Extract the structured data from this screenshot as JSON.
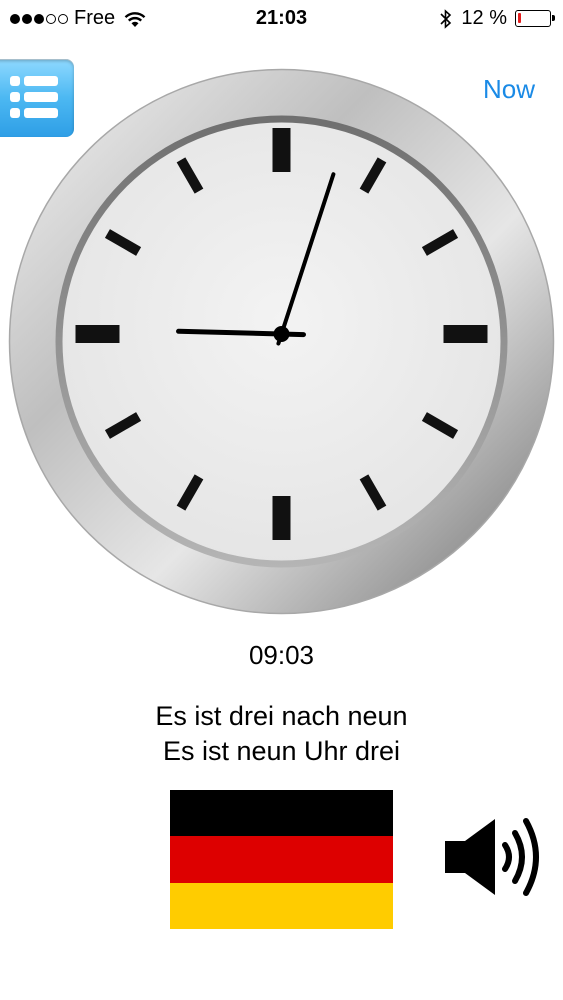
{
  "status_bar": {
    "carrier": "Free",
    "time": "21:03",
    "battery_text": "12 %",
    "battery_level": 0.12,
    "signal_bars_total": 5,
    "signal_bars_filled": 3
  },
  "header": {
    "menu_icon": "list-menu-icon",
    "now_label": "Now"
  },
  "clock": {
    "hour": 9,
    "minute": 3
  },
  "display": {
    "digital_time": "09:03",
    "phrase_primary": "Es ist drei nach neun",
    "phrase_secondary": "Es ist neun Uhr drei"
  },
  "language": {
    "flag_icon": "germany-flag-icon",
    "flag_colors": [
      "#000000",
      "#dd0000",
      "#ffcc00"
    ]
  },
  "audio": {
    "speaker_icon": "speaker-volume-icon"
  },
  "colors": {
    "accent": "#1a8ae6",
    "menu_button": "#4cb8f2"
  }
}
